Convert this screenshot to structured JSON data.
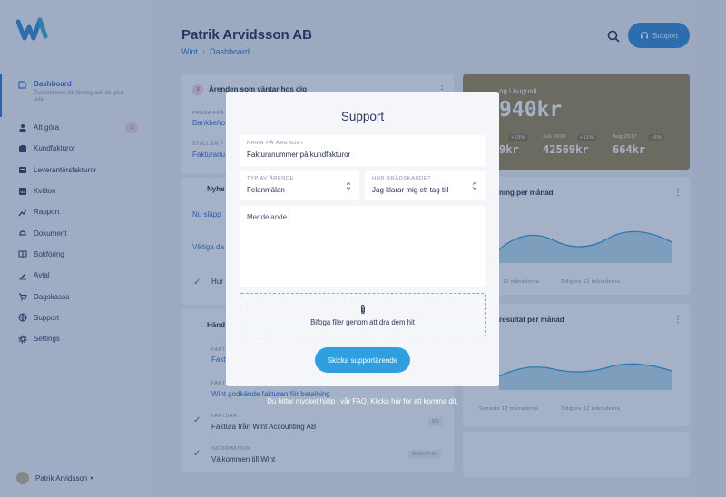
{
  "header": {
    "title": "Patrik Arvidsson AB",
    "breadcrumb": [
      "Wint",
      "Dashboard"
    ],
    "support_label": "Support"
  },
  "sidebar": {
    "items": [
      {
        "label": "Dashboard",
        "sub": "Översikt över ditt företag och att göra-lista",
        "icon": "dashboard-icon",
        "active": true
      },
      {
        "label": "Att göra",
        "icon": "todo-icon",
        "badge": "2"
      },
      {
        "label": "Kundfakturor",
        "icon": "invoice-icon"
      },
      {
        "label": "Leverantörsfakturor",
        "icon": "supplier-invoice-icon"
      },
      {
        "label": "Kvitton",
        "icon": "receipt-icon"
      },
      {
        "label": "Rapport",
        "icon": "report-icon"
      },
      {
        "label": "Dokument",
        "icon": "document-icon"
      },
      {
        "label": "Bokföring",
        "icon": "bookkeeping-icon"
      },
      {
        "label": "Avtal",
        "icon": "contract-icon"
      },
      {
        "label": "Dagskassa",
        "icon": "cash-register-icon"
      },
      {
        "label": "Support",
        "icon": "support-icon"
      },
      {
        "label": "Settings",
        "icon": "settings-icon"
      }
    ],
    "user": "Patrik Arvidsson"
  },
  "background": {
    "tasks_title": "Ärenden som väntar hos dig",
    "tasks_badge": "3",
    "task1_small": "FRÅGA FRÅ",
    "task1_link": "Bankbeho",
    "task2_small": "STÄLL EN F",
    "task2_link": "Fakturanu",
    "news_title": "Nyhe",
    "news1": "Nu släpp",
    "news2": "Viktiga da",
    "news3": "Hur",
    "events_title": "Händ",
    "ev1_small": "FAKT",
    "ev1_link": "Faktu",
    "ev2_small": "FAKT",
    "ev2_link": "Wint godkände fakturan för betalning",
    "ev3_small": "FAKTURA",
    "ev3_text": "Faktura från Wint Accounting AB",
    "ev3_date": "5/9",
    "ev4_small": "INFORMATION",
    "ev4_text": "Välkommen till Wint",
    "ev4_date": "2020-07-24",
    "stat_heading": "ng i Augusti",
    "stat_big": "940kr",
    "stat1": "9kr",
    "stat2_label": "Juli 2019",
    "stat2_change": "+11%",
    "stat2": "42569kr",
    "stat3_label": "Aug 2017",
    "stat3_change": "+6%",
    "stat3": "664kr",
    "stat1_change": "+13%",
    "chart1_title": "ning per månad",
    "chart1_legend": [
      "12 månaderna",
      "Tidigare 12 månaderna"
    ],
    "chart2_title": "resultat per månad",
    "chart2_legend": [
      "Senaste 12 månaderna",
      "Tidigare 12 månaderna"
    ]
  },
  "modal": {
    "title": "Support",
    "name_label": "NAMN PÅ ÄRENDET",
    "name_value": "Fakturanummer på kundfakturor",
    "type_label": "TYP AV ÄRENDE",
    "type_value": "Felanmälan",
    "urgency_label": "HUR BRÅDSKANDE?",
    "urgency_value": "Jag klarar mig ett tag till",
    "message_placeholder": "Meddelande",
    "attach_text": "Bifoga filer genom att dra dem hit",
    "submit_label": "Skicka supportärende",
    "faq_text": "Du hittar mycket hjälp i vår FAQ. Klicka här för att komma dit."
  },
  "colors": {
    "accent": "#2f6fd9",
    "button": "#2f9fdf",
    "stat_card": "#9e8752",
    "overlay": "#284476"
  }
}
